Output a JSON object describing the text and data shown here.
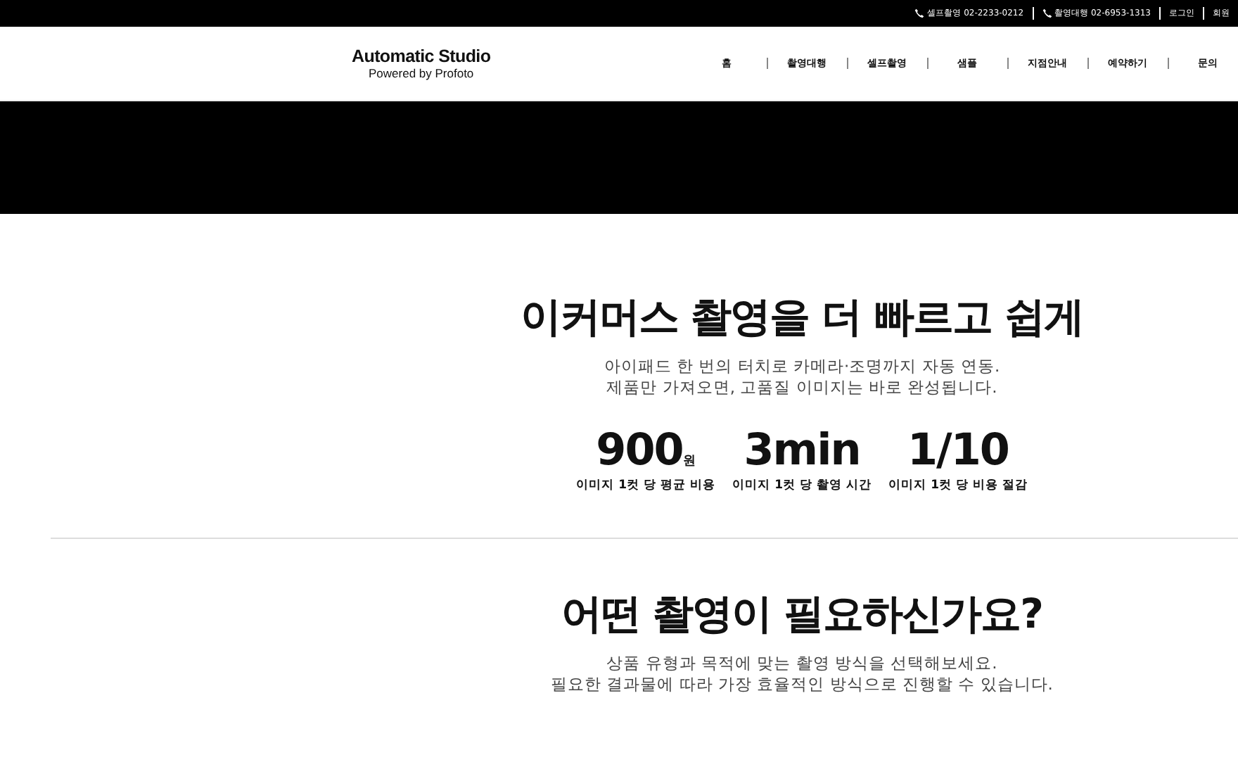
{
  "top_bar": {
    "contacts": [
      {
        "label": "셀프촬영 02-2233-0212"
      },
      {
        "label": "촬영대행 02-6953-1313"
      }
    ],
    "links": [
      "로그인",
      "회원"
    ]
  },
  "header": {
    "logo": {
      "title": "Automatic Studio",
      "subtitle": "Powered by Profoto"
    },
    "nav": [
      "홈",
      "촬영대행",
      "셀프촬영",
      "샘플",
      "지점안내",
      "예약하기",
      "문의"
    ]
  },
  "intro": {
    "title": "이커머스 촬영을 더 빠르고 쉽게",
    "lines": [
      "아이패드 한 번의 터치로 카메라·조명까지 자동 연동.",
      "제품만 가져오면, 고품질 이미지는 바로 완성됩니다."
    ],
    "stats": [
      {
        "value": "900",
        "unit": "원",
        "label": "이미지 1컷 당 평균 비용"
      },
      {
        "value": "3min",
        "label": "이미지 1컷 당 촬영 시간"
      },
      {
        "value": "1/10",
        "label": "이미지 1컷 당 비용 절감"
      }
    ]
  },
  "question": {
    "title": "어떤 촬영이 필요하신가요?",
    "lines": [
      "상품 유형과 목적에 맞는 촬영 방식을 선택해보세요.",
      "필요한 결과물에 따라 가장 효율적인 방식으로 진행할 수 있습니다."
    ]
  }
}
